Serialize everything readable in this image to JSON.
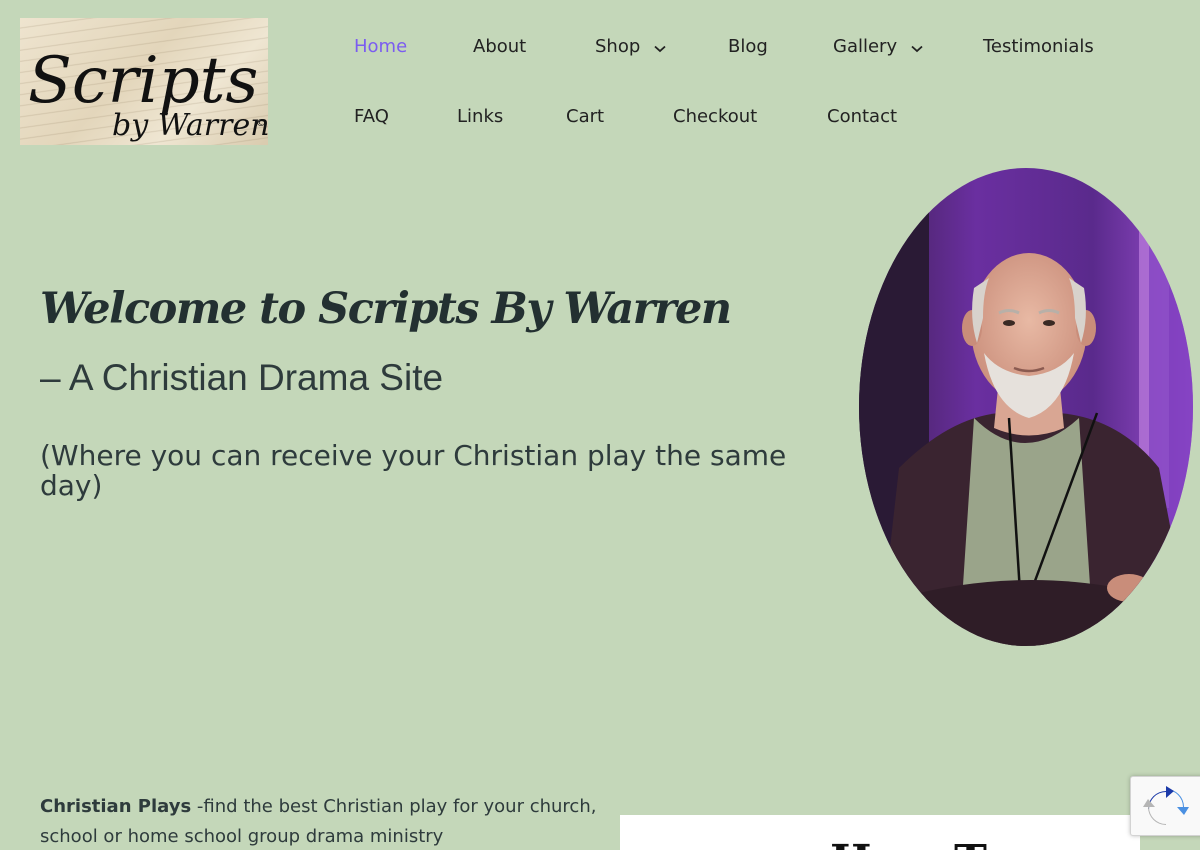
{
  "logo": {
    "line1": "Scripts",
    "line2": "by Warren",
    "mark": "©"
  },
  "nav": {
    "row1": [
      {
        "label": "Home",
        "active": true,
        "dropdown": false
      },
      {
        "label": "About",
        "active": false,
        "dropdown": false
      },
      {
        "label": "Shop",
        "active": false,
        "dropdown": true
      },
      {
        "label": "Blog",
        "active": false,
        "dropdown": false
      },
      {
        "label": "Gallery",
        "active": false,
        "dropdown": true
      },
      {
        "label": "Testimonials",
        "active": false,
        "dropdown": false
      }
    ],
    "row2": [
      {
        "label": "FAQ"
      },
      {
        "label": "Links"
      },
      {
        "label": "Cart"
      },
      {
        "label": "Checkout"
      },
      {
        "label": "Contact"
      }
    ],
    "active_color": "#7b5cf0",
    "dropdown_icon": "chevron-down-icon"
  },
  "hero": {
    "title": "Welcome to Scripts By Warren",
    "subtitle": "– A Christian Drama Site",
    "note": "(Where you can receive your Christian play the same day)"
  },
  "intro": {
    "bold": "Christian Plays",
    "text": " -find the best Christian play for your church, school or home school group drama ministry"
  },
  "panel": {
    "heading": "How To"
  },
  "colors": {
    "background": "#c4d7b9",
    "text": "#2e3b3c"
  },
  "recaptcha_icon": "recaptcha-icon"
}
